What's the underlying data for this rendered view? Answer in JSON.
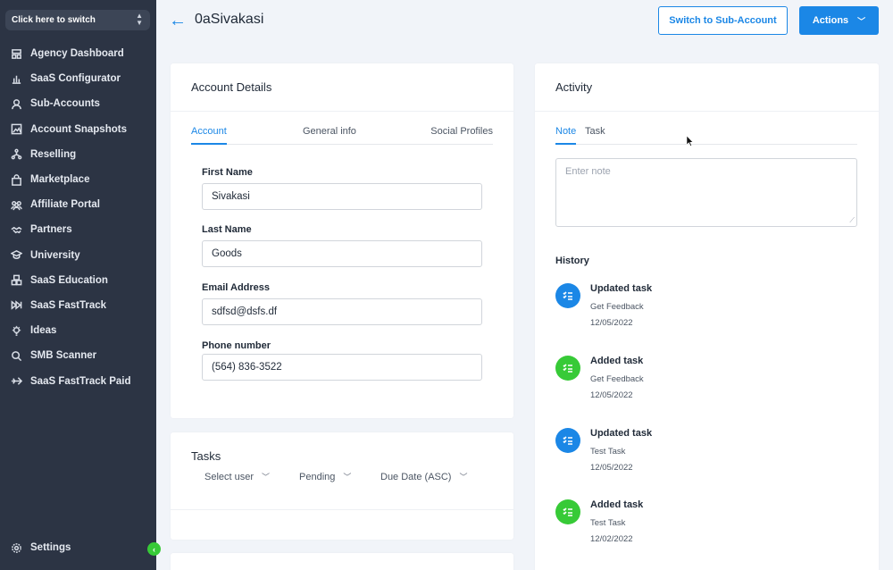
{
  "colors": {
    "accent": "#1b87e6",
    "sidebar_bg": "#2c3444",
    "success": "#37ca37"
  },
  "sidebar": {
    "switcher_label": "Click here to switch",
    "items": [
      {
        "label": "Agency Dashboard",
        "icon": "dashboard-icon"
      },
      {
        "label": "SaaS Configurator",
        "icon": "bar-chart-icon"
      },
      {
        "label": "Sub-Accounts",
        "icon": "user-icon"
      },
      {
        "label": "Account Snapshots",
        "icon": "image-icon"
      },
      {
        "label": "Reselling",
        "icon": "network-icon"
      },
      {
        "label": "Marketplace",
        "icon": "bag-icon"
      },
      {
        "label": "Affiliate Portal",
        "icon": "users-icon"
      },
      {
        "label": "Partners",
        "icon": "handshake-icon"
      },
      {
        "label": "University",
        "icon": "graduation-cap-icon"
      },
      {
        "label": "SaaS Education",
        "icon": "cubes-icon"
      },
      {
        "label": "SaaS FastTrack",
        "icon": "fast-forward-icon"
      },
      {
        "label": "Ideas",
        "icon": "lightbulb-icon"
      },
      {
        "label": "SMB Scanner",
        "icon": "search-icon"
      },
      {
        "label": "SaaS FastTrack Paid",
        "icon": "plane-icon"
      }
    ],
    "settings_label": "Settings"
  },
  "header": {
    "title": "0aSivakasi",
    "switch_button": "Switch to Sub-Account",
    "actions_button": "Actions"
  },
  "account": {
    "title": "Account Details",
    "tabs": [
      "Account",
      "General info",
      "Social Profiles"
    ],
    "fields": {
      "first_name": {
        "label": "First Name",
        "value": "Sivakasi"
      },
      "last_name": {
        "label": "Last Name",
        "value": "Goods"
      },
      "email": {
        "label": "Email Address",
        "value": "sdfsd@dsfs.df"
      },
      "phone": {
        "label": "Phone number",
        "value": "(564) 836-3522"
      }
    }
  },
  "tasks": {
    "title": "Tasks",
    "filters": [
      "Select user",
      "Pending",
      "Due Date (ASC)"
    ]
  },
  "activity": {
    "title": "Activity",
    "tabs": [
      "Note",
      "Task"
    ],
    "note_placeholder": "Enter note",
    "history_label": "History",
    "history": [
      {
        "title": "Updated task",
        "subtitle": "Get Feedback",
        "date": "12/05/2022",
        "color": "#1b87e6"
      },
      {
        "title": "Added task",
        "subtitle": "Get Feedback",
        "date": "12/05/2022",
        "color": "#37ca37"
      },
      {
        "title": "Updated task",
        "subtitle": "Test Task",
        "date": "12/05/2022",
        "color": "#1b87e6"
      },
      {
        "title": "Added task",
        "subtitle": "Test Task",
        "date": "12/02/2022",
        "color": "#37ca37"
      }
    ]
  }
}
